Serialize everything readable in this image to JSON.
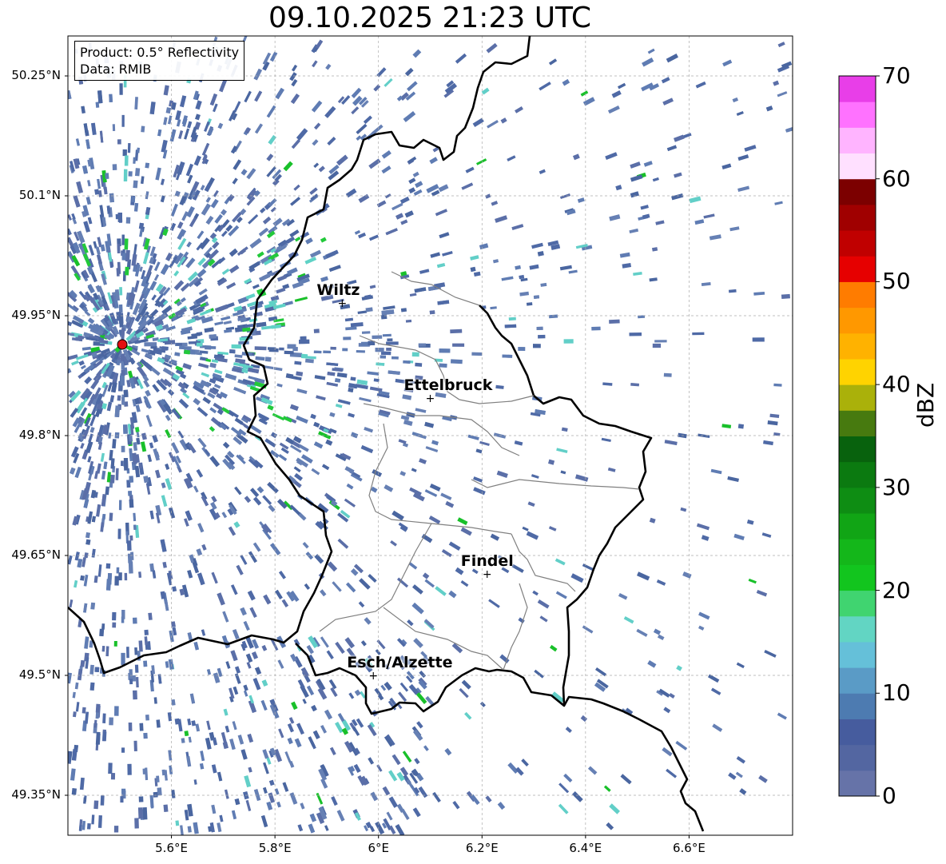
{
  "title": "09.10.2025 21:23 UTC",
  "info": {
    "product": "Product: 0.5° Reflectivity",
    "source": "Data: RMIB"
  },
  "cities": [
    {
      "name": "Wiltz",
      "lon": 5.93,
      "lat": 49.966
    },
    {
      "name": "Ettelbruck",
      "lon": 6.1,
      "lat": 49.847
    },
    {
      "name": "Findel",
      "lon": 6.21,
      "lat": 49.627
    },
    {
      "name": "Esch/Alzette",
      "lon": 5.99,
      "lat": 49.5
    }
  ],
  "radar_site": {
    "lon": 5.505,
    "lat": 49.914
  },
  "lat_ticks": [
    "50.25°N",
    "50.1°N",
    "49.95°N",
    "49.8°N",
    "49.65°N",
    "49.5°N",
    "49.35°N"
  ],
  "lon_ticks": [
    "5.6°E",
    "5.8°E",
    "6°E",
    "6.2°E",
    "6.4°E",
    "6.6°E"
  ],
  "colorbar": {
    "label": "dBZ",
    "min": 0,
    "max": 70,
    "step": 2.5,
    "ticks": [
      "70",
      "60",
      "50",
      "40",
      "30",
      "20",
      "10",
      "0"
    ],
    "colors": [
      "#6673a8",
      "#5366a1",
      "#465c9e",
      "#4d7bb1",
      "#5a9bc6",
      "#65c0d9",
      "#62d5c3",
      "#40d470",
      "#12c51e",
      "#14b71a",
      "#11a515",
      "#0e8d13",
      "#0b7a10",
      "#08620d",
      "#477a0f",
      "#aab10a",
      "#ffd300",
      "#ffb200",
      "#ff9800",
      "#ff7c00",
      "#e60000",
      "#c00000",
      "#a00000",
      "#7c0000",
      "#ffe0ff",
      "#ffb4ff",
      "#ff72ff",
      "#e83ee8"
    ]
  }
}
